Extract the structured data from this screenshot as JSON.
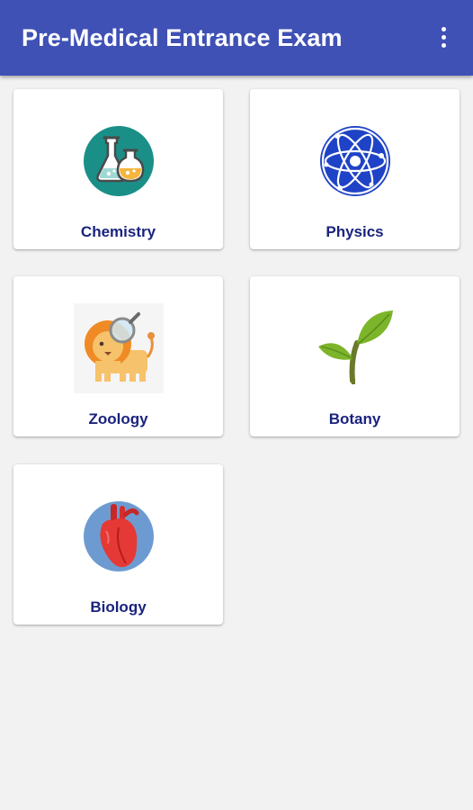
{
  "app_bar": {
    "title": "Pre-Medical Entrance Exam",
    "menu_icon": "more-vert-icon",
    "color": "#3f51b5"
  },
  "subjects": [
    {
      "label": "Chemistry",
      "icon": "flask-icon"
    },
    {
      "label": "Physics",
      "icon": "atom-icon"
    },
    {
      "label": "Zoology",
      "icon": "lion-magnifier-icon"
    },
    {
      "label": "Botany",
      "icon": "plant-sprout-icon"
    },
    {
      "label": "Biology",
      "icon": "heart-icon"
    }
  ],
  "colors": {
    "background": "#f2f2f2",
    "card": "#ffffff",
    "label": "#1a237e"
  }
}
